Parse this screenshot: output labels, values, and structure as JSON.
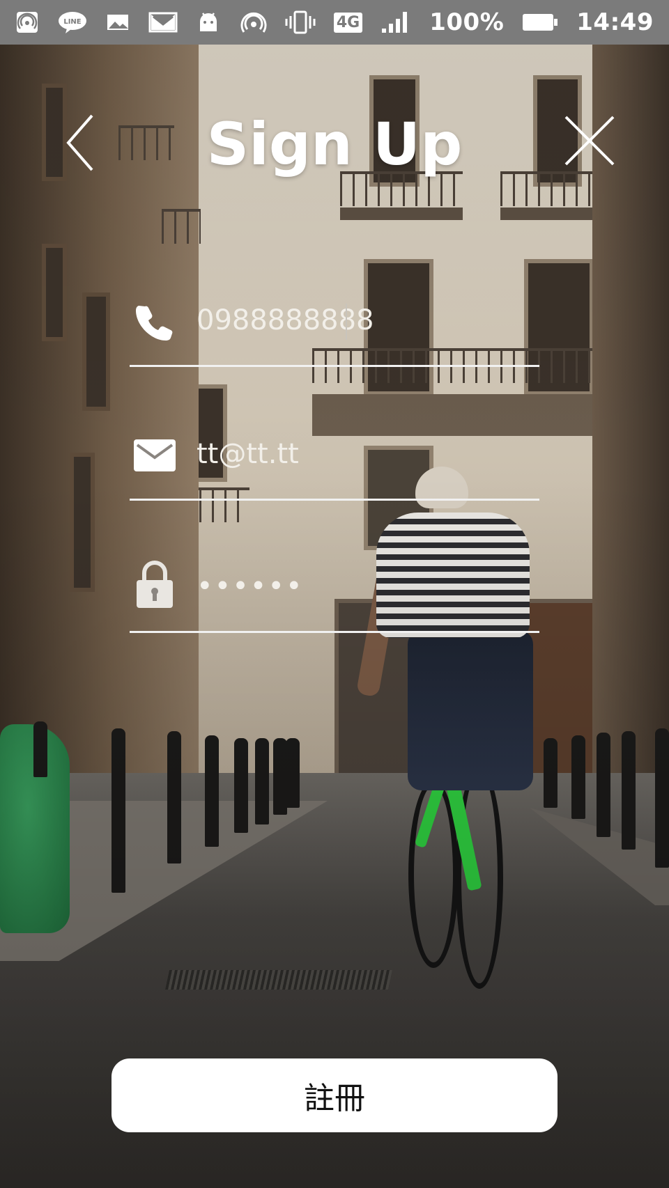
{
  "status_bar": {
    "network_type": "4G",
    "battery": "100%",
    "time": "14:49",
    "left_icons": [
      "hotspot-icon",
      "line-app-icon",
      "gallery-icon",
      "gmail-icon",
      "android-debug-icon"
    ],
    "right_icons": [
      "wifi-hotspot-icon",
      "vibrate-icon",
      "network-4g-icon",
      "signal-icon",
      "battery-icon"
    ]
  },
  "header": {
    "title": "Sign Up",
    "back_icon": "chevron-left-icon",
    "close_icon": "close-icon"
  },
  "form": {
    "phone": {
      "icon": "phone-icon",
      "value": "0988888888"
    },
    "email": {
      "icon": "mail-icon",
      "value": "tt@tt.tt"
    },
    "password": {
      "icon": "lock-icon",
      "value": "••••••"
    }
  },
  "submit_button": {
    "label": "註冊"
  },
  "colors": {
    "status_bar_bg": "#7b7b7b",
    "text_primary": "#ffffff",
    "input_text": "#f2efe9",
    "underline": "#f1f1f1",
    "button_bg": "#ffffff",
    "button_text": "#111111"
  }
}
